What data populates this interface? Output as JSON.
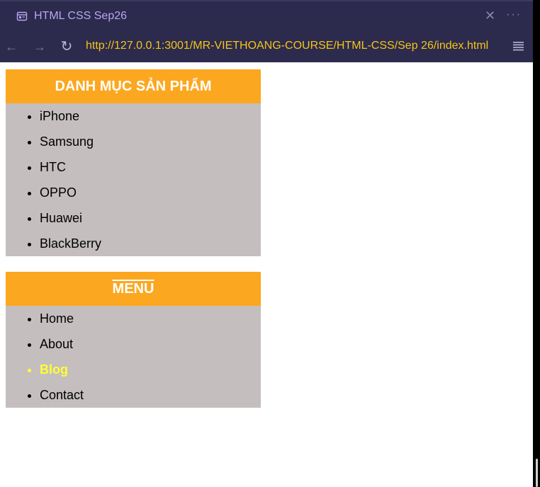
{
  "tab": {
    "title": "HTML CSS Sep26",
    "close_glyph": "✕",
    "more_glyph": "···"
  },
  "navigation": {
    "back_glyph": "←",
    "forward_glyph": "→",
    "reload_glyph": "↻",
    "url": "http://127.0.0.1:3001/MR-VIETHOANG-COURSE/HTML-CSS/Sep 26/index.html"
  },
  "categories": {
    "heading": "DANH MỤC SẢN PHẨM",
    "items": [
      "iPhone",
      "Samsung",
      "HTC",
      "OPPO",
      "Huawei",
      "BlackBerry"
    ]
  },
  "menu": {
    "heading": "MENU",
    "items": [
      "Home",
      "About",
      "Blog",
      "Contact"
    ],
    "active_item": "Blog"
  },
  "colors": {
    "chrome_bg": "#2c2a4d",
    "url_text": "#f5c518",
    "tab_text": "#b9a7f0",
    "box_header": "#fca720",
    "box_body": "#c4bebe",
    "active_link": "#ffff33"
  }
}
